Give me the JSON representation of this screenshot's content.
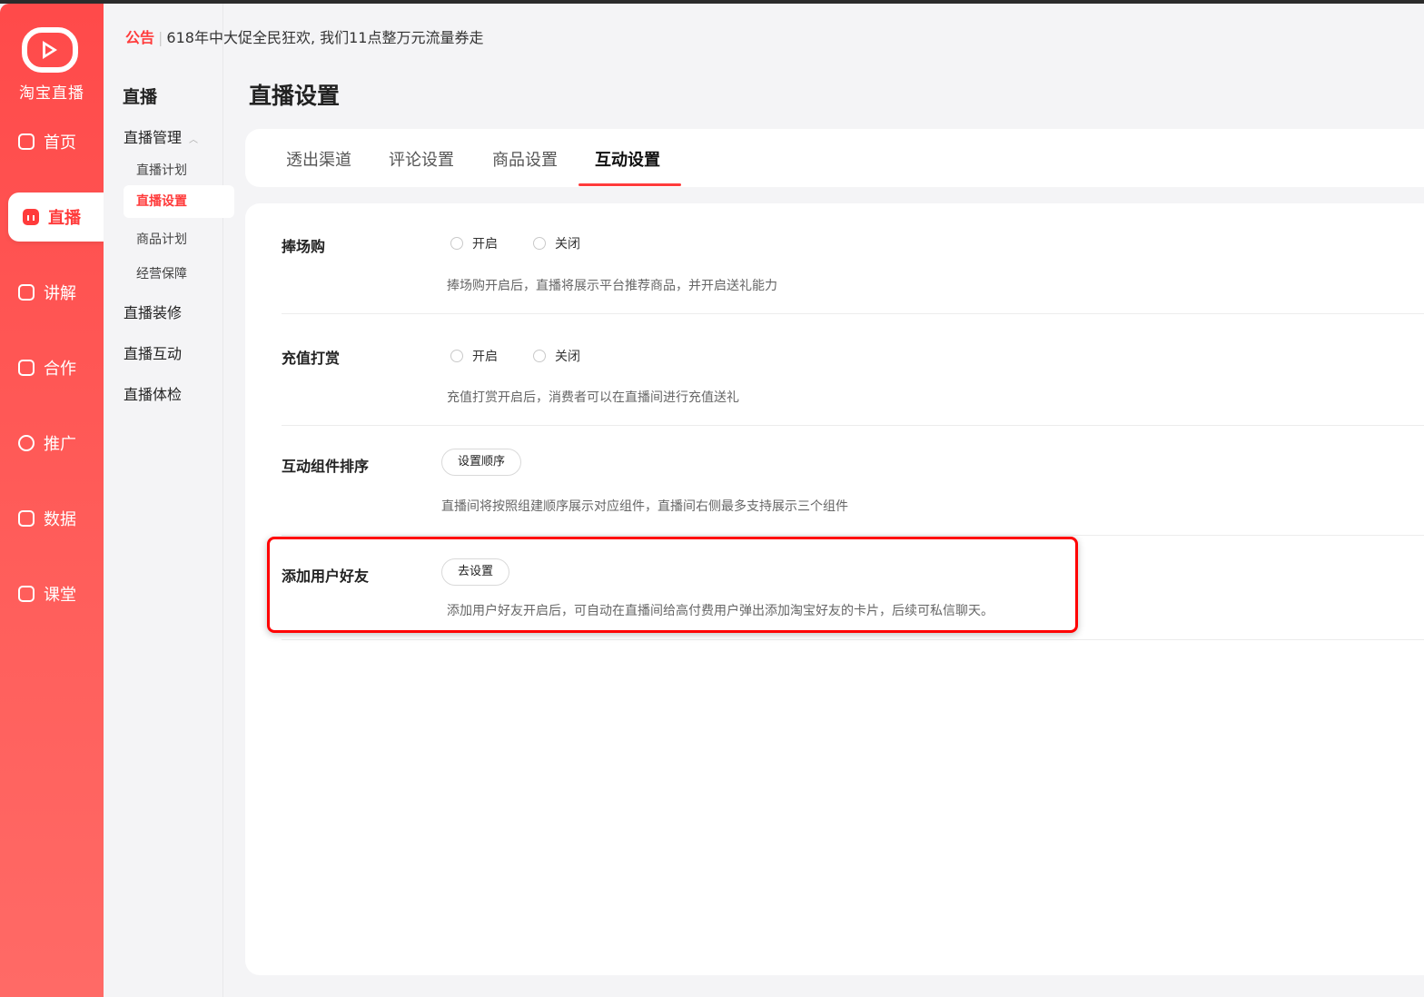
{
  "app": {
    "brand_name": "淘宝直播",
    "accent_color": "#ff3b3b"
  },
  "nav": {
    "items": [
      {
        "label": "首页",
        "icon": "home-icon"
      },
      {
        "label": "直播",
        "icon": "live-chart-icon",
        "active": true
      },
      {
        "label": "讲解",
        "icon": "play-box-icon"
      },
      {
        "label": "合作",
        "icon": "bag-icon"
      },
      {
        "label": "推广",
        "icon": "bulb-icon"
      },
      {
        "label": "数据",
        "icon": "data-chart-icon"
      },
      {
        "label": "课堂",
        "icon": "book-icon"
      }
    ]
  },
  "subnav": {
    "title": "直播",
    "group_live_manage": "直播管理",
    "items": [
      "直播计划",
      "直播设置",
      "商品计划",
      "经营保障"
    ],
    "group_decor": "直播装修",
    "group_interact": "直播互动",
    "group_check": "直播体检"
  },
  "notice": {
    "tag": "公告",
    "text": "618年中大促全民狂欢, 我们11点整万元流量券走"
  },
  "page": {
    "title": "直播设置"
  },
  "tabs": [
    "透出渠道",
    "评论设置",
    "商品设置",
    "互动设置"
  ],
  "active_tab": "互动设置",
  "settings": {
    "pengchanggou": {
      "label": "捧场购",
      "on": "开启",
      "off": "关闭",
      "desc": "捧场购开启后，直播将展示平台推荐商品，并开启送礼能力"
    },
    "recharge": {
      "label": "充值打赏",
      "on": "开启",
      "off": "关闭",
      "desc": "充值打赏开启后，消费者可以在直播间进行充值送礼"
    },
    "widget_order": {
      "label": "互动组件排序",
      "button": "设置顺序",
      "desc": "直播间将按照组建顺序展示对应组件，直播间右侧最多支持展示三个组件"
    },
    "add_friend": {
      "label": "添加用户好友",
      "button": "去设置",
      "desc": "添加用户好友开启后，可自动在直播间给高付费用户弹出添加淘宝好友的卡片，后续可私信聊天。"
    }
  }
}
